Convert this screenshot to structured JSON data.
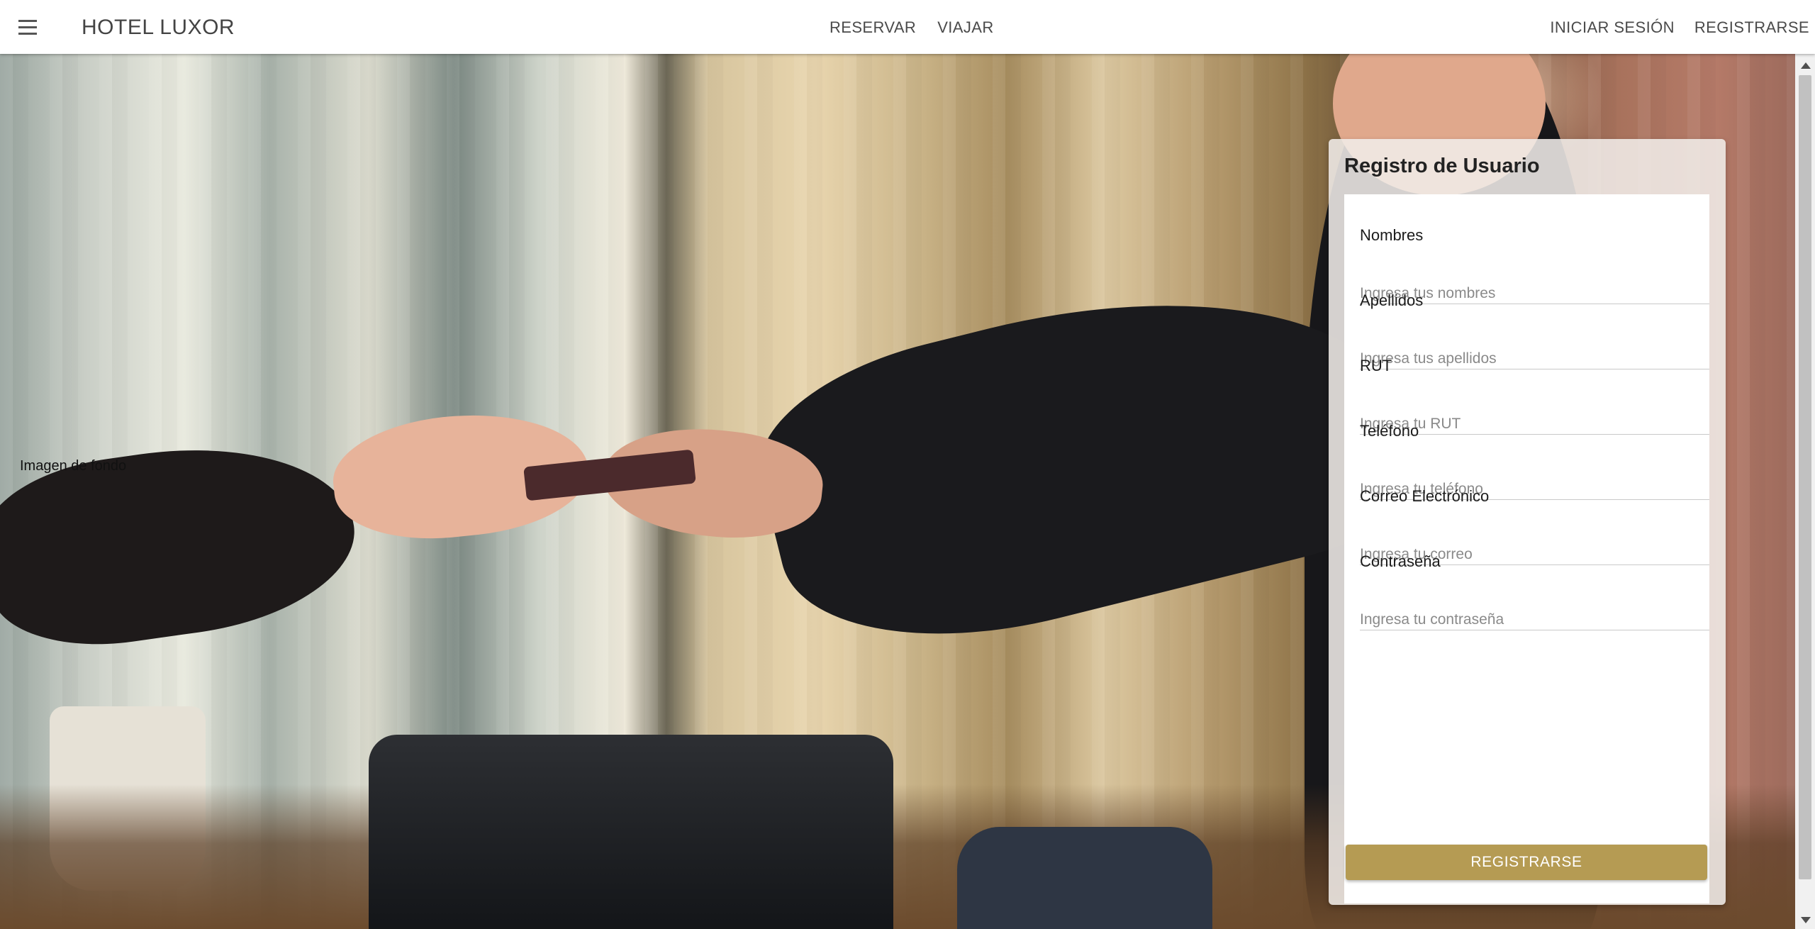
{
  "header": {
    "brand": "HOTEL LUXOR",
    "nav_center": [
      "RESERVAR",
      "VIAJAR"
    ],
    "nav_right": [
      "INICIAR SESIÓN",
      "REGISTRARSE"
    ]
  },
  "hero": {
    "alt_text": "Imagen de fondo"
  },
  "registration": {
    "title": "Registro de Usuario",
    "fields": [
      {
        "label": "Nombres",
        "placeholder": "Ingresa tus nombres",
        "value": ""
      },
      {
        "label": "Apellidos",
        "placeholder": "Ingresa tus apellidos",
        "value": ""
      },
      {
        "label": "RUT",
        "placeholder": "Ingresa tu RUT",
        "value": ""
      },
      {
        "label": "Teléfono",
        "placeholder": "Ingresa tu teléfono",
        "value": ""
      },
      {
        "label": "Correo Electrónico",
        "placeholder": "Ingresa tu correo",
        "value": ""
      },
      {
        "label": "Contraseña",
        "placeholder": "Ingresa tu contraseña",
        "value": ""
      }
    ],
    "submit_label": "REGISTRARSE"
  },
  "colors": {
    "accent": "#b59b53",
    "appbar": "#ffffff"
  },
  "icons": {
    "menu": "hamburger-menu-icon"
  }
}
